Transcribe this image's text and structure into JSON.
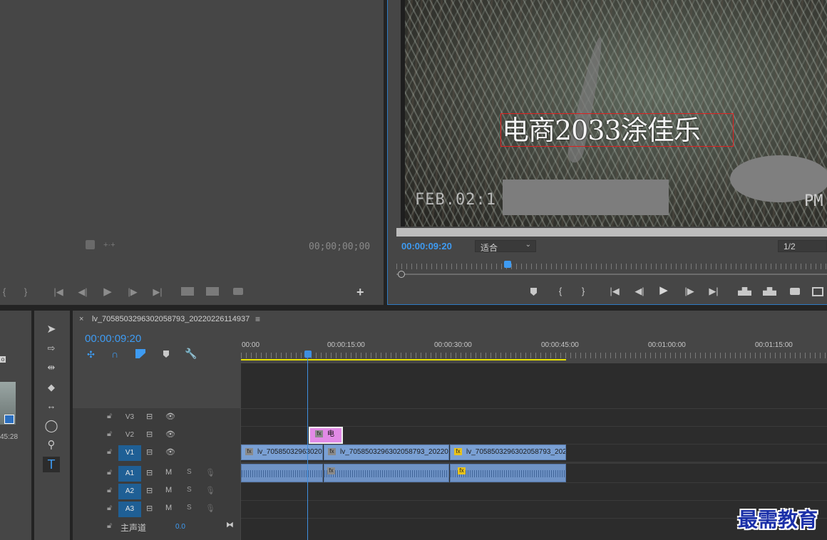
{
  "source_monitor": {
    "timecode": "00;00;00;00",
    "controls": [
      "{",
      "}",
      "|◀",
      "◀|",
      "▶",
      "|▶",
      "▶|"
    ]
  },
  "program_monitor": {
    "title_overlay": "电商2033涂佳乐",
    "date_stamp": "FEB.02:1",
    "date_stamp_right": "PM",
    "timecode": "00:00:09:20",
    "fit_dropdown": "适合",
    "resolution_dropdown": "1/2",
    "controls": [
      "{",
      "}",
      "|◀",
      "◀|",
      "▶",
      "|▶",
      "▶|"
    ]
  },
  "timeline": {
    "sequence_name": "lv_7058503296302058793_20220226114937",
    "close_glyph": "×",
    "menu_glyph": "≡",
    "timecode": "00:00:09:20",
    "ruler_labels": [
      "00:00",
      "00:00:15:00",
      "00:00:30:00",
      "00:00:45:00",
      "00:01:00:00",
      "00:01:15:00"
    ],
    "tracks": {
      "v3": "V3",
      "v2": "V2",
      "v1": "V1",
      "a1": "A1",
      "a2": "A2",
      "a3": "A3",
      "master": "主声道",
      "master_value": "0.0"
    },
    "track_buttons": {
      "mute": "M",
      "solo": "S"
    },
    "clips": {
      "title_clip": "电",
      "v1_clip_1": "lv_70585032963020",
      "v1_clip_2": "lv_7058503296302058793_202202",
      "v1_clip_3": "lv_7058503296302058793_202",
      "fx": "fx"
    }
  },
  "project_panel": {
    "thumb_time": "45:28",
    "badge": "o"
  },
  "watermark": "最需教育",
  "colors": {
    "accent_blue": "#3e9bf2",
    "panel_bg": "#464646",
    "track_bg": "#2c2c2c",
    "clip_blue": "#7aa0d4",
    "title_clip_pink": "#e28ae6",
    "work_area_yellow": "#e6e000",
    "title_box_red": "#e02020",
    "watermark_blue": "#1a2fa8"
  }
}
